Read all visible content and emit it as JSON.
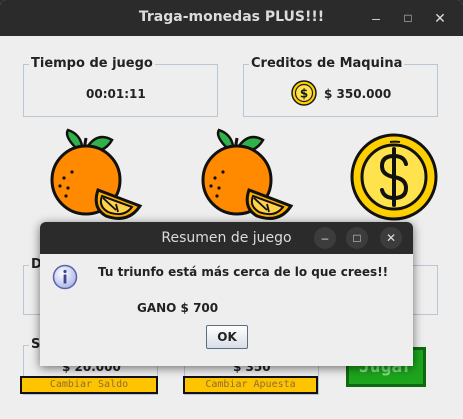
{
  "window": {
    "title": "Traga-monedas PLUS!!!",
    "minimize": "–",
    "maximize": "□",
    "close": "✕"
  },
  "panels": {
    "tiempo": {
      "legend": "Tiempo de juego",
      "value": "00:01:11"
    },
    "creditos": {
      "legend": "Creditos de Maquina",
      "value": "$ 350.000",
      "icon": "coin-icon"
    },
    "d_partial": {
      "legend": "D"
    },
    "saldo": {
      "legend": "S",
      "value": "$ 20.000",
      "button": "Cambiar Saldo"
    },
    "apuesta": {
      "value": "$ 350",
      "button": "Cambiar Apuesta"
    }
  },
  "reels": [
    "orange-icon",
    "orange-icon",
    "coin-icon"
  ],
  "jugar_label": "Jugar",
  "dialog": {
    "title": "Resumen de juego",
    "message": "Tu triunfo está más cerca de lo que crees!!",
    "amount": "GANO $ 700",
    "ok": "OK",
    "icon": "info-icon"
  },
  "colors": {
    "titlebar": "#2b2b2b",
    "window_bg": "#eeeeee",
    "button_yellow": "#ffc400",
    "jugar_green": "#1da51d",
    "orange": "#ff8a00",
    "coin": "#ffd000"
  }
}
